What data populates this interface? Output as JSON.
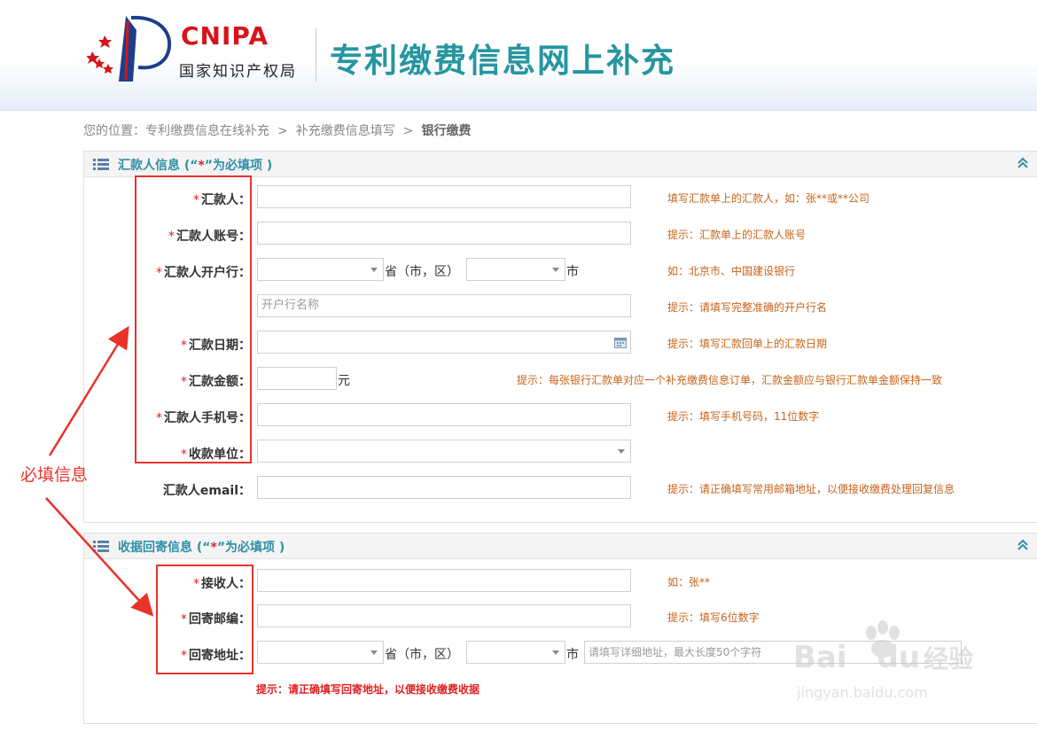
{
  "header": {
    "logo_en": "CNIPA",
    "logo_cn": "国家知识产权局",
    "title": "专利缴费信息网上补充"
  },
  "breadcrumb": {
    "prefix": "您的位置：",
    "items": [
      "专利缴费信息在线补充",
      "补充缴费信息填写",
      "银行缴费"
    ],
    "separator": ">"
  },
  "remitter_section": {
    "title_prefix": "汇款人信息 (“",
    "title_star": "*",
    "title_suffix": "”为必填项 )",
    "fields": {
      "remitter": {
        "label": "汇款人：",
        "hint": "填写汇款单上的汇款人，如：张**或**公司"
      },
      "account": {
        "label": "汇款人账号：",
        "hint": "提示：汇款单上的汇款人账号"
      },
      "bank": {
        "label": "汇款人开户行：",
        "province_unit": "省（市，区）",
        "city_unit": "市",
        "hint": "如：北京市、中国建设银行"
      },
      "bank_name": {
        "placeholder": "开户行名称",
        "hint": "提示：请填写完整准确的开户行名"
      },
      "date": {
        "label": "汇款日期：",
        "hint": "提示：填写汇款回单上的汇款日期"
      },
      "amount": {
        "label": "汇款金额：",
        "unit": "元",
        "hint": "提示：每张银行汇款单对应一个补充缴费信息订单，汇款金额应与银行汇款单金额保持一致"
      },
      "phone": {
        "label": "汇款人手机号：",
        "hint": "提示：填写手机号码，11位数字"
      },
      "payee": {
        "label": "收款单位："
      },
      "email": {
        "label": "汇款人email：",
        "hint": "提示：请正确填写常用邮箱地址，以便接收缴费处理回复信息"
      }
    },
    "required_star": "*"
  },
  "receipt_section": {
    "title_prefix": "收据回寄信息 (“",
    "title_star": "*",
    "title_suffix": "”为必填项 )",
    "fields": {
      "receiver": {
        "label": "接收人：",
        "hint": "如：张**"
      },
      "postcode": {
        "label": "回寄邮编：",
        "hint": "提示：填写6位数字"
      },
      "address": {
        "label": "回寄地址：",
        "province_unit": "省（市，区）",
        "city_unit": "市",
        "placeholder": "请填写详细地址，最大长度50个字符"
      }
    },
    "note": "提示：请正确填写回寄地址，以便接收缴费收据"
  },
  "annotation": {
    "text": "必填信息",
    "color": "#e8332a"
  },
  "watermark": {
    "brand": "Bai",
    "brand2": "du",
    "cn": "经验",
    "url": "jingyan.baidu.com"
  },
  "colors": {
    "accent": "#2696a0",
    "hint": "#c8631a",
    "required": "#e02020",
    "logo_red": "#d7141a"
  }
}
